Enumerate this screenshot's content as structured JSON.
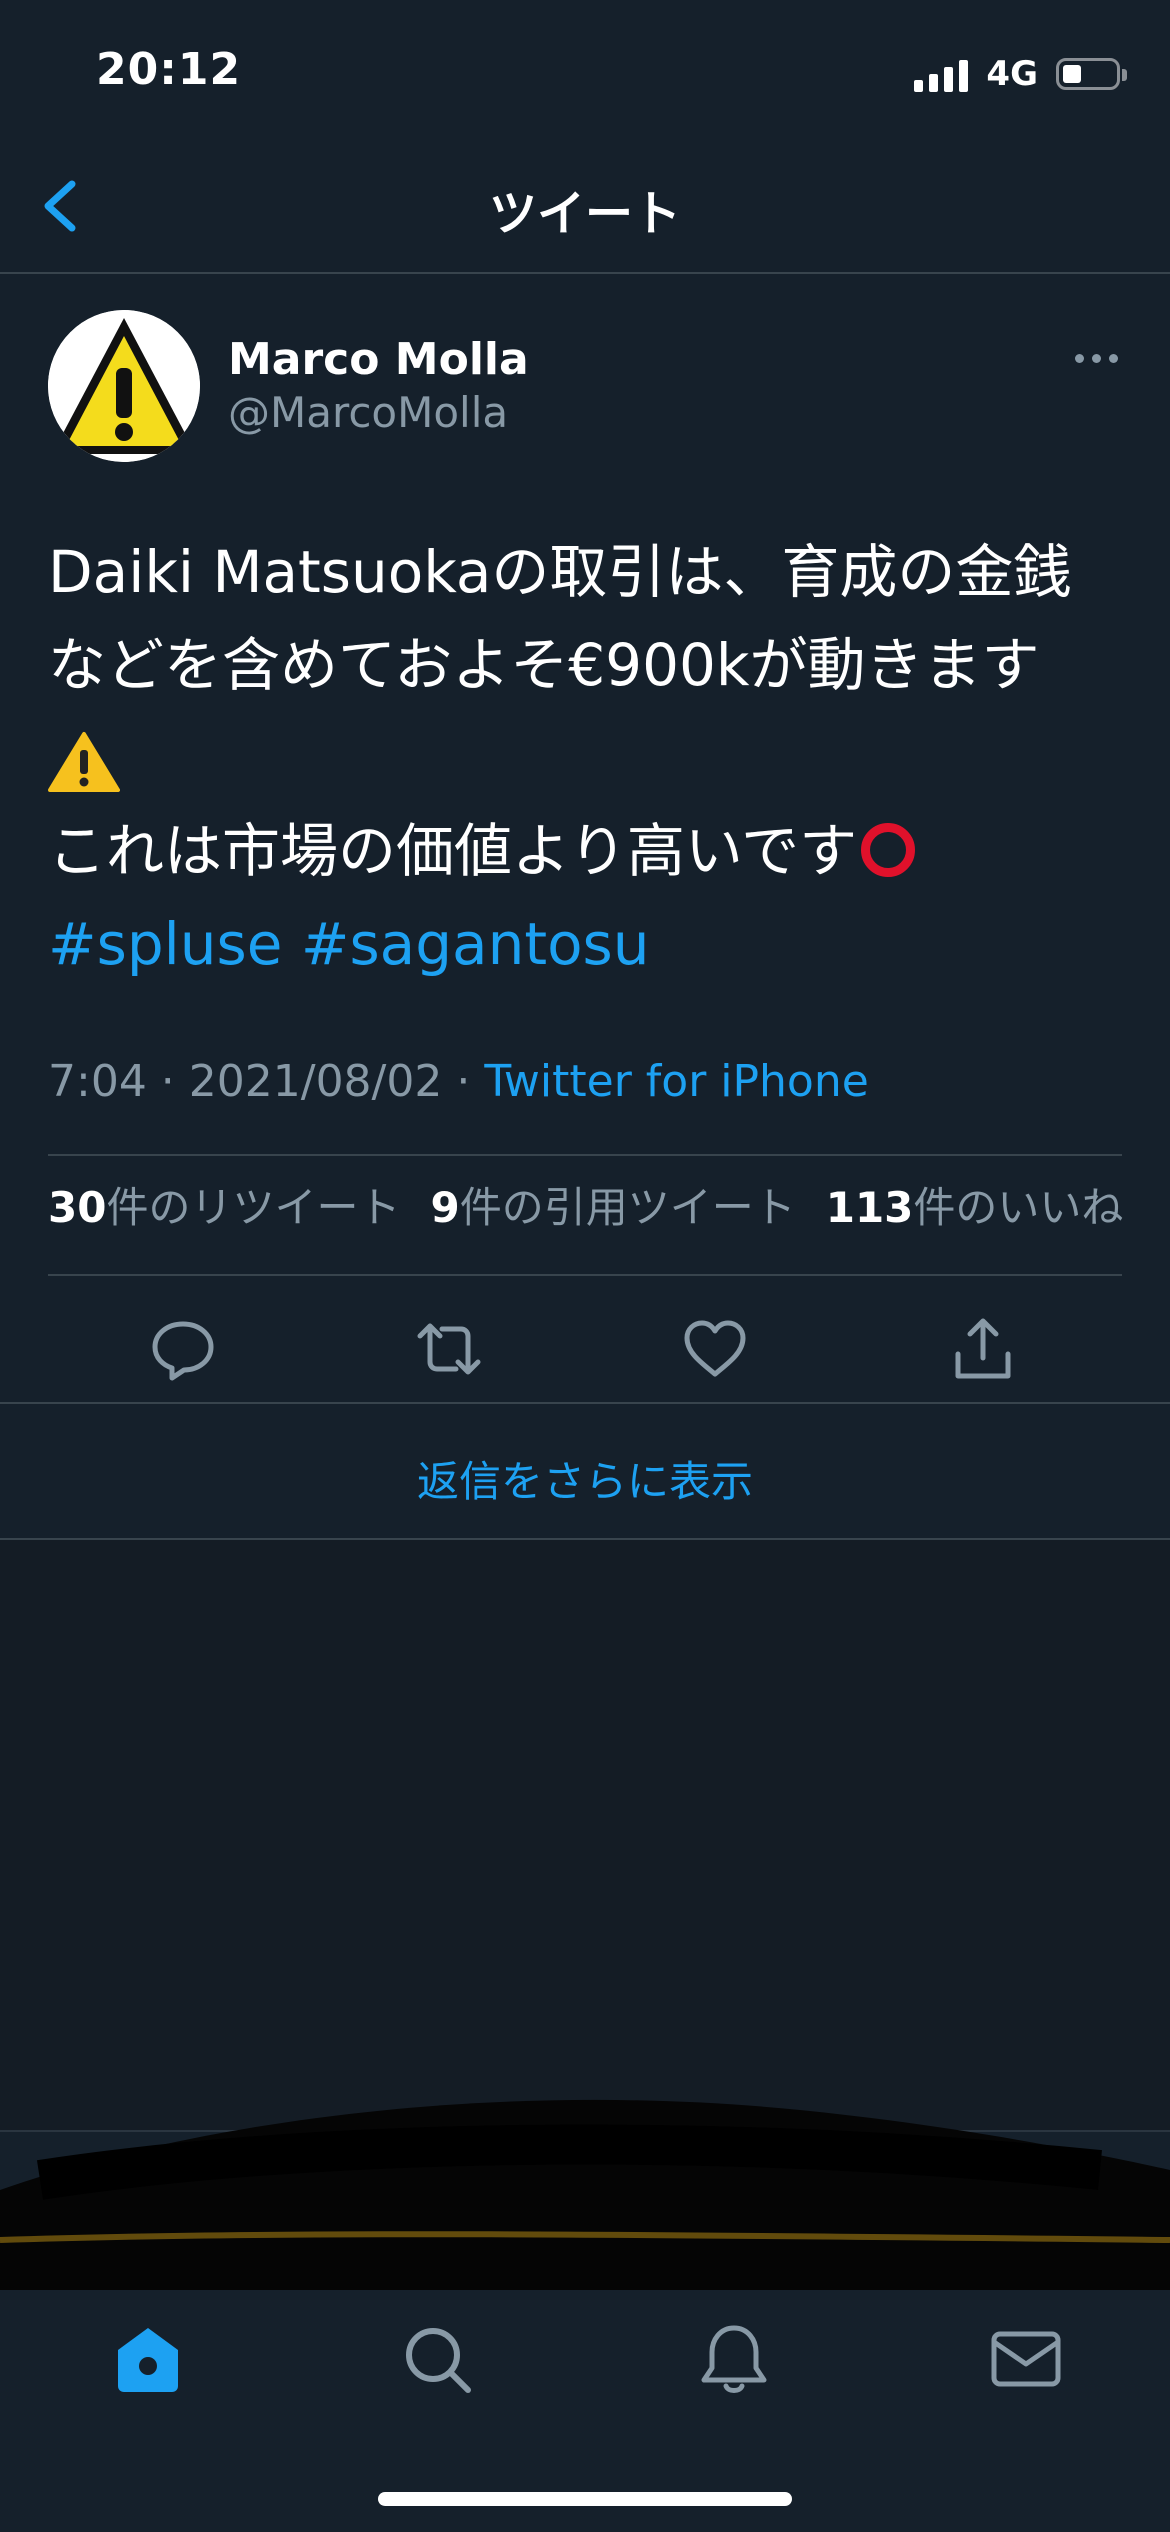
{
  "status": {
    "time": "20:12",
    "network": "4G"
  },
  "nav": {
    "title": "ツイート",
    "back_icon": "chevron-left-icon"
  },
  "tweet": {
    "display_name": "Marco Molla",
    "handle": "@MarcoMolla",
    "text_lines": [
      "Daiki Matsuokaの取引は、育成の金銭",
      "などを含めておよそ€900kが動きます",
      "これは市場の価値より高いです"
    ],
    "hashtags": [
      "#spluse",
      "#sagantosu"
    ],
    "time": "7:04 · 2021/08/02 · ",
    "source": "Twitter for iPhone",
    "stats": {
      "retweets_count": "30",
      "retweets_label": "件のリツイート",
      "quotes_count": "9",
      "quotes_label": "件の引用ツイート",
      "likes_count": "113",
      "likes_label": "件のいいね"
    }
  },
  "more_replies": "返信をさらに表示",
  "colors": {
    "background": "#15202b",
    "accent": "#1da1f2",
    "muted": "#8899a6",
    "divider": "#38444d"
  }
}
